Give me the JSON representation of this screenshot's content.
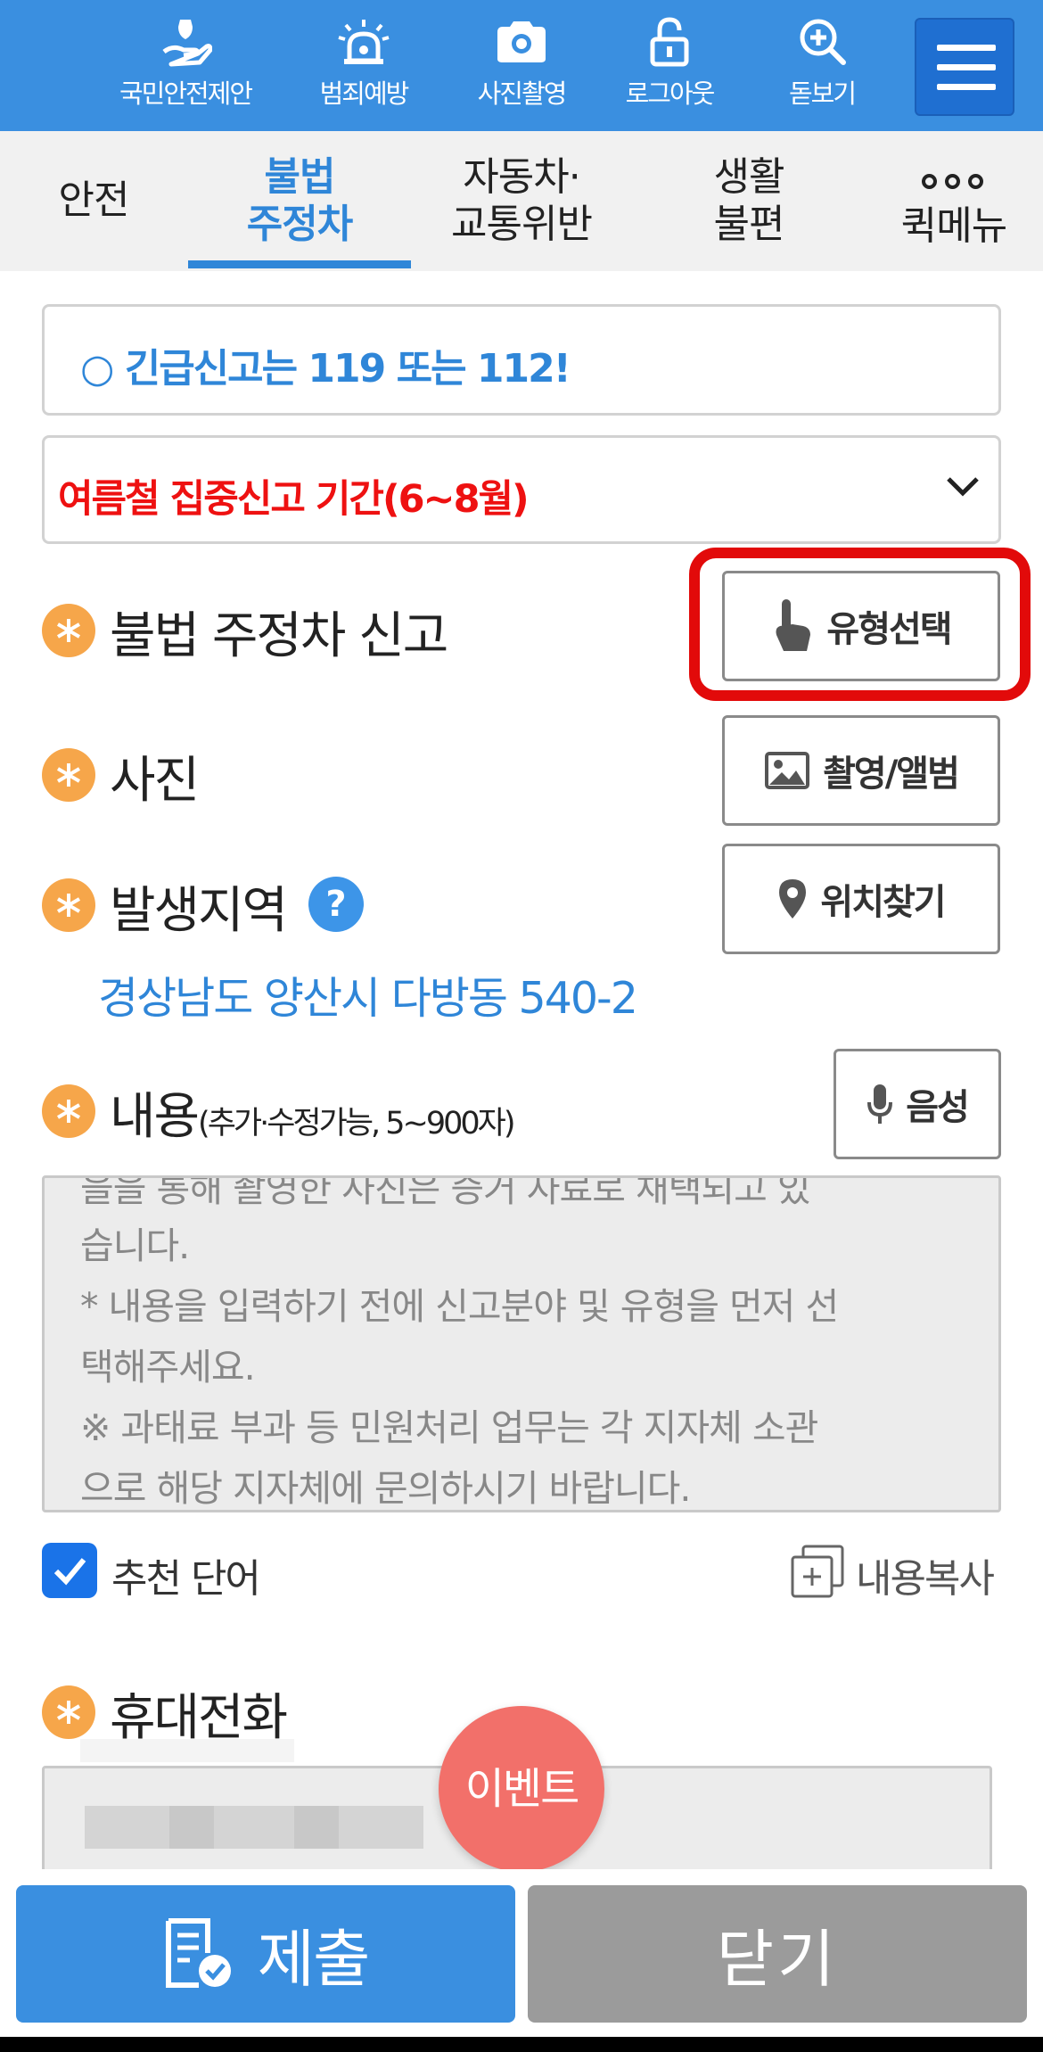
{
  "top_nav": {
    "items": [
      {
        "label": "국민안전제안",
        "icon": "hand-shield-icon"
      },
      {
        "label": "범죄예방",
        "icon": "siren-icon"
      },
      {
        "label": "사진촬영",
        "icon": "camera-icon"
      },
      {
        "label": "로그아웃",
        "icon": "lock-icon"
      },
      {
        "label": "돋보기",
        "icon": "magnifier-plus-icon"
      }
    ],
    "menu_icon": "hamburger-menu-icon"
  },
  "tabs": {
    "items": [
      {
        "label": "안전"
      },
      {
        "label": "불법\n주정차",
        "active": true
      },
      {
        "label": "자동차·\n교통위반"
      },
      {
        "label": "생활\n불편"
      },
      {
        "label": "퀵메뉴",
        "icon": "more-dots-icon"
      }
    ]
  },
  "notices": {
    "emergency": "○ 긴급신고는 119 또는 112!",
    "summer_period": "여름철 집중신고 기간(6~8월)"
  },
  "form": {
    "report_type": {
      "label": "불법 주정차 신고",
      "button": "유형선택"
    },
    "photo": {
      "label": "사진",
      "button": "촬영/앨범"
    },
    "location": {
      "label": "발생지역",
      "help": "?",
      "button": "위치찾기",
      "address": "경상남도 양산시 다방동 540-2"
    },
    "content": {
      "label": "내용",
      "hint": "(추가·수정가능, 5~900자)",
      "voice_button": "음성",
      "lines": [
        "을을 통해 촬영한 사진은 증거 자료로 채택되고 있",
        "습니다.",
        "* 내용을 입력하기 전에 신고분야 및 유형을 먼저 선",
        "택해주세요.",
        "※ 과태료 부과 등 민원처리 업무는 각 지자체 소관",
        "으로 해당 지자체에 문의하시기 바랍니다."
      ]
    },
    "recommend": {
      "label": "추천 단어",
      "checked": true
    },
    "copy": {
      "label": "내용복사"
    },
    "phone": {
      "label": "휴대전화"
    }
  },
  "event_button": "이벤트",
  "actions": {
    "submit": "제출",
    "close": "닫기"
  },
  "colors": {
    "primary": "#3a8fe0",
    "accent_red": "#ee1111",
    "highlight": "#e20a0a",
    "required_star": "#f6a64a",
    "event": "#f2706a"
  }
}
